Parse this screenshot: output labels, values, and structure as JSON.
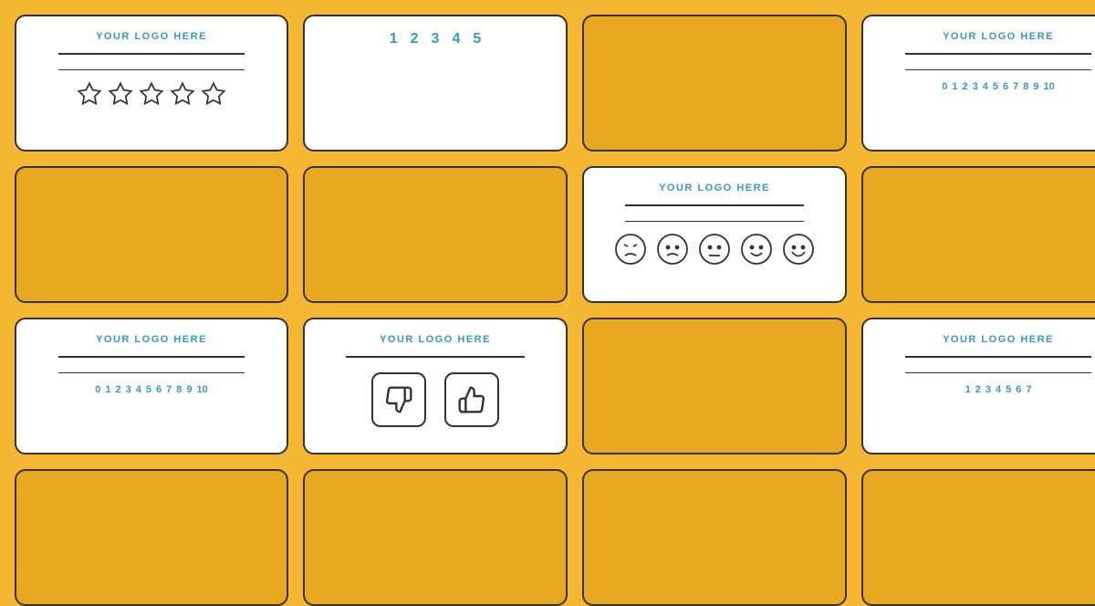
{
  "background_color": "#F5B731",
  "cards": {
    "logo_text": "YOUR LOGO HERE",
    "logo_text_2": "YOUR LOGO HERE",
    "logo_text_3": "YOUR LOGO HERE",
    "logo_text_4": "YOUR LOGO HERE",
    "logo_text_5": "YOUR LOGO HERE",
    "scale_1_5": [
      "1",
      "2",
      "3",
      "4",
      "5"
    ],
    "scale_0_10": [
      "0",
      "1",
      "2",
      "3",
      "4",
      "5",
      "6",
      "7",
      "8",
      "9",
      "10"
    ],
    "scale_0_10_wide": [
      "0",
      "1",
      "2",
      "3",
      "4",
      "5",
      "6",
      "7",
      "8",
      "9",
      "10"
    ],
    "scale_1_7": [
      "1",
      "2",
      "3",
      "4",
      "5",
      "6",
      "7"
    ],
    "stars": [
      "☆",
      "☆",
      "☆",
      "☆",
      "☆"
    ],
    "emojis": [
      "😠",
      "🙁",
      "😐",
      "🙂",
      "😊"
    ]
  }
}
